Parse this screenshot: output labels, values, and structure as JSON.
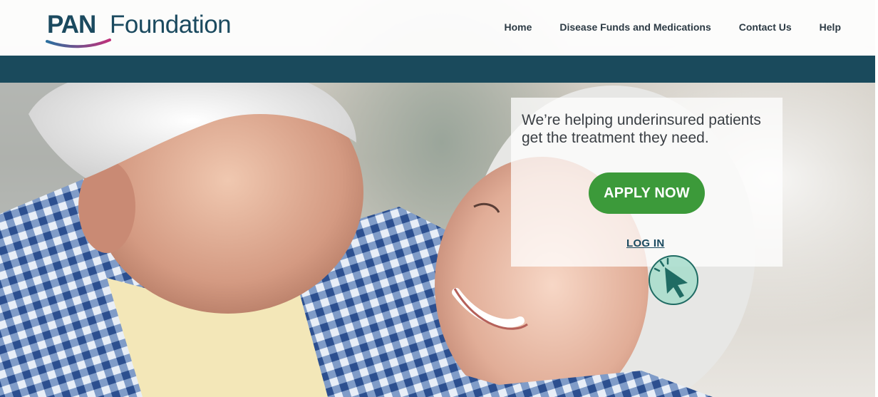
{
  "brand": {
    "name_bold": "PAN",
    "name_rest": "Foundation",
    "primary_color": "#1b4a5f",
    "swoosh_colors": [
      "#2a6f9e",
      "#c0307a"
    ]
  },
  "nav": {
    "items": [
      {
        "label": "Home"
      },
      {
        "label": "Disease Funds and Medications"
      },
      {
        "label": "Contact Us"
      },
      {
        "label": "Help"
      }
    ]
  },
  "band": {
    "color": "#1a4a5c"
  },
  "hero": {
    "headline": "We’re helping underinsured patients get the treatment they need.",
    "apply_label": "APPLY NOW",
    "apply_color": "#3c9a3a",
    "login_label": "LOG IN"
  },
  "cursor": {
    "icon": "pointer-click-icon",
    "color": "#1f6b63",
    "ring_color": "#a6dccb"
  }
}
